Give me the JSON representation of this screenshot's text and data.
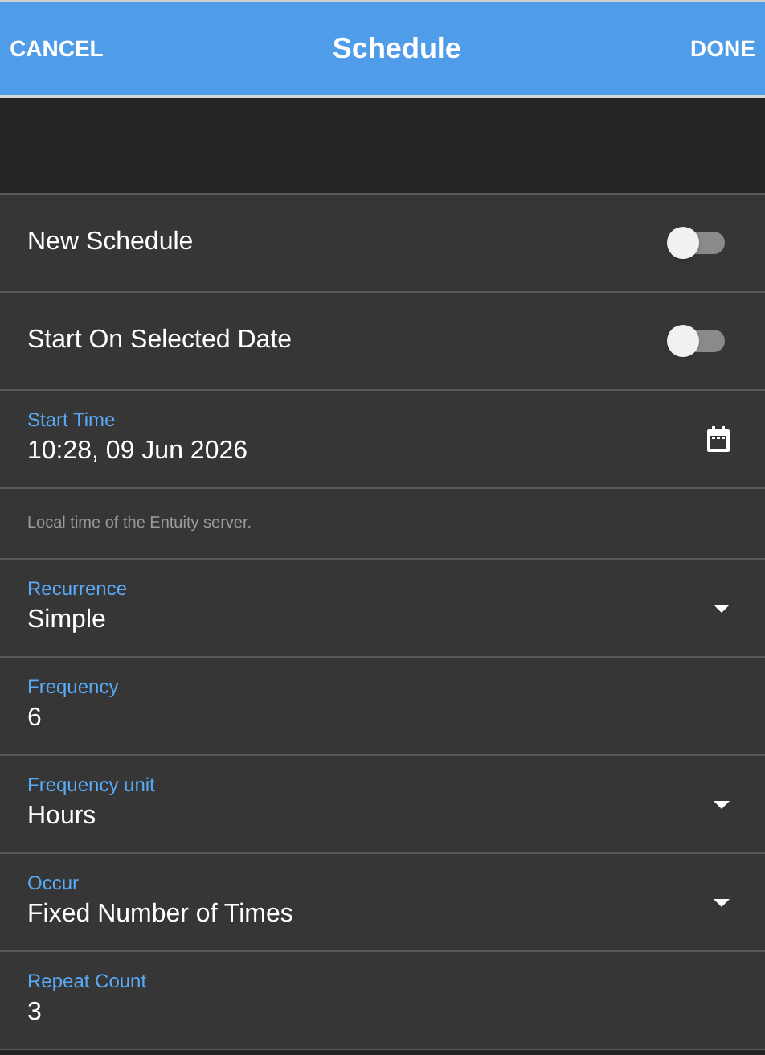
{
  "header": {
    "cancel": "CANCEL",
    "title": "Schedule",
    "done": "DONE"
  },
  "fields": [
    {
      "kind": "toggle",
      "label": "New Schedule",
      "on": false
    },
    {
      "kind": "toggle",
      "label": "Start On Selected Date",
      "on": false
    },
    {
      "kind": "date",
      "label": "Start Time",
      "value": "10:28, 09 Jun 2026"
    },
    {
      "kind": "note",
      "text": "Local time of the Entuity server."
    },
    {
      "kind": "select",
      "label": "Recurrence",
      "value": "Simple"
    },
    {
      "kind": "text",
      "label": "Frequency",
      "value": "6"
    },
    {
      "kind": "select",
      "label": "Frequency unit",
      "value": "Hours"
    },
    {
      "kind": "select",
      "label": "Occur",
      "value": "Fixed Number of Times"
    },
    {
      "kind": "text",
      "label": "Repeat Count",
      "value": "3"
    }
  ]
}
